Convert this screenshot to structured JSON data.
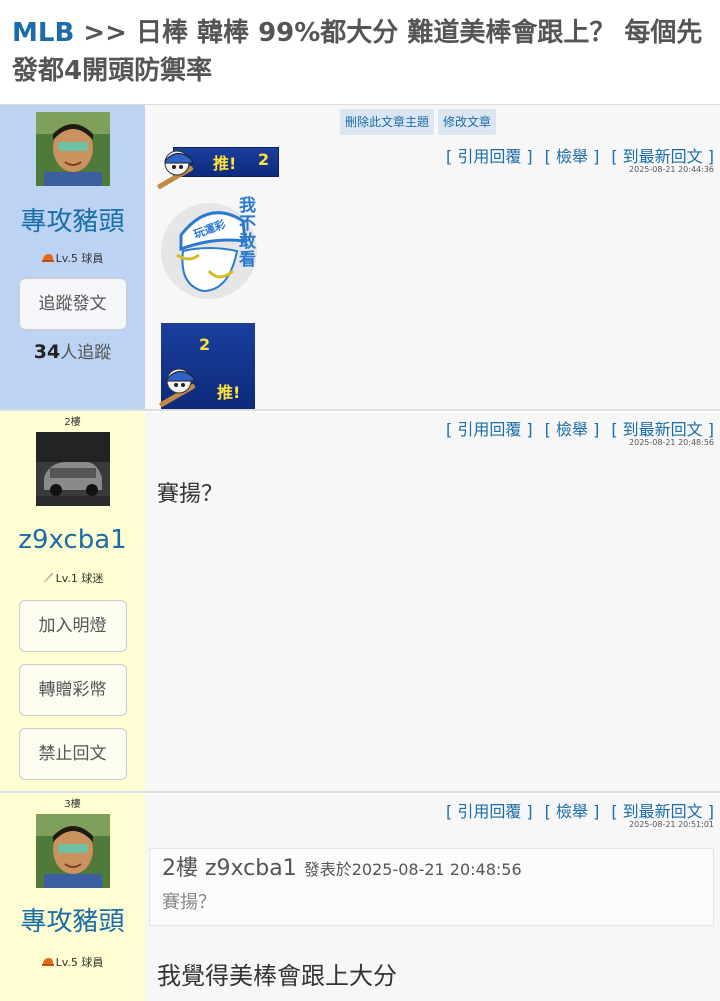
{
  "header": {
    "category": "MLB",
    "separator": ">>",
    "title": "日棒 韓棒 99%都大分 難道美棒會跟上？ 每個先發都4開頭防禦率"
  },
  "colors": {
    "link": "#1a6da8",
    "op_sidebar": "#bcd3f4",
    "reply_sidebar": "#fefed2"
  },
  "posts": [
    {
      "floor": "",
      "username": "專攻豬頭",
      "level": "Lv.5 球員",
      "level_icon": "baseball-cap-icon",
      "owner_buttons": [
        "刪除此文章主題",
        "修改文章"
      ],
      "actions": [
        "[ 引用回覆 ]",
        "[ 檢舉 ]",
        "[ 到最新回文 ]"
      ],
      "time": "2025-08-21 20:44:36",
      "side_buttons": [
        "追蹤發文"
      ],
      "followers_count": "34",
      "followers_suffix": "人追蹤",
      "stickers": {
        "push_top_text": "推!",
        "push_top_num": "2",
        "dare_text": "我不敢看",
        "cap_text": "玩運彩",
        "push_bottom_num": "2",
        "push_bottom_text": "推!"
      }
    },
    {
      "floor": "2樓",
      "username": "z9xcba1",
      "level": "Lv.1 球迷",
      "level_icon": "pencil-icon",
      "actions": [
        "[ 引用回覆 ]",
        "[ 檢舉 ]",
        "[ 到最新回文 ]"
      ],
      "time": "2025-08-21 20:48:56",
      "content": "賽揚？",
      "side_buttons": [
        "加入明燈",
        "轉贈彩幣",
        "禁止回文"
      ]
    },
    {
      "floor": "3樓",
      "username": "專攻豬頭",
      "level": "Lv.5 球員",
      "level_icon": "baseball-cap-icon",
      "actions": [
        "[ 引用回覆 ]",
        "[ 檢舉 ]",
        "[ 到最新回文 ]"
      ],
      "time": "2025-08-21 20:51:01",
      "quote": {
        "floor": "2樓",
        "user": "z9xcba1",
        "posted_prefix": "發表於",
        "posted_time": "2025-08-21 20:48:56",
        "text": "賽揚？"
      },
      "content": "我覺得美棒會跟上大分"
    }
  ]
}
